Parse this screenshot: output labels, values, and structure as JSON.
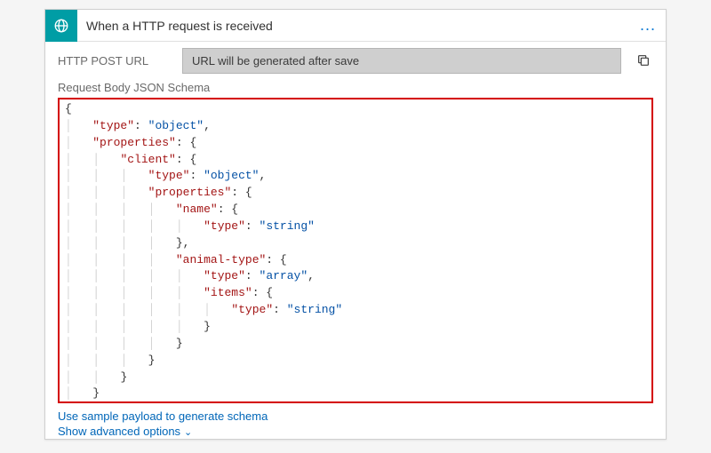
{
  "header": {
    "title": "When a HTTP request is received",
    "icon": "http-trigger-icon",
    "more": "..."
  },
  "urlRow": {
    "label": "HTTP POST URL",
    "value": "URL will be generated after save"
  },
  "schemaSection": {
    "label": "Request Body JSON Schema"
  },
  "schema": {
    "type": "object",
    "properties": {
      "client": {
        "type": "object",
        "properties": {
          "name": {
            "type": "string"
          },
          "animal-type": {
            "type": "array",
            "items": {
              "type": "string"
            }
          }
        }
      }
    }
  },
  "links": {
    "samplePayload": "Use sample payload to generate schema",
    "advanced": "Show advanced options"
  }
}
